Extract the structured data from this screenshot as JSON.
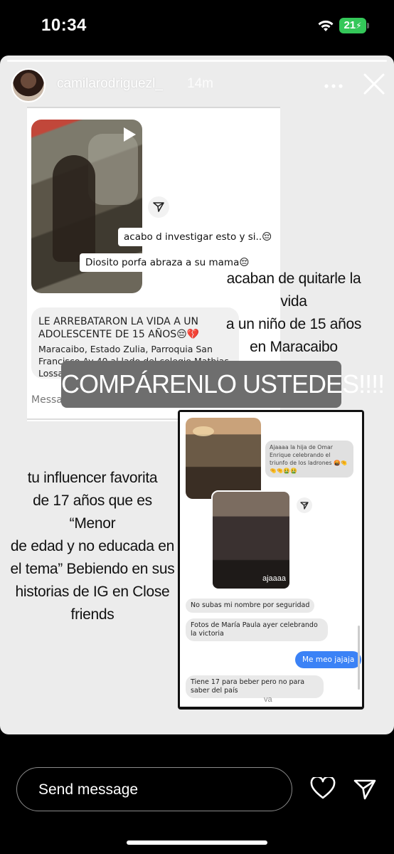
{
  "status_bar": {
    "time": "10:34",
    "battery": "21"
  },
  "story": {
    "username": "camilarodriguezl_",
    "time_ago": "14m",
    "screenshot_1": {
      "bubble_1": "acabo d investigar esto y si..😔",
      "bubble_2": "Diosito porfa abraza a su mama😔",
      "message_lines": [
        "LE ARREBATARON LA VIDA A UN",
        "ADOLESCENTE DE 15 AÑOS😔💔",
        " Maracaibo, Estado Zulia, Parroquia San",
        "Francisco Av 40 al lado del colegio Mathias",
        "Lossada"
      ],
      "input_placeholder": "Message..."
    },
    "overlay_right": [
      "acaban de quitarle la vida",
      "a un niño de 15 años",
      "en Maracaibo"
    ],
    "headline": "COMPÁRENLO USTEDES!!!!",
    "overlay_left": [
      "tu influencer favorita",
      "de 17 años que es “Menor",
      "de edad y no educada en",
      "el tema” Bebiendo en sus",
      "historias de IG en Close",
      "friends"
    ],
    "screenshot_2": {
      "reply_text": "Ajaaaa la hija de Omar Enrique celebrando el triunfo de los ladrones 🤬🤏🤏🤏🤮🤮",
      "photo_label": "ajaaaa",
      "bubble_1": "No subas mi nombre por seguridad",
      "bubble_2": "Fotos de María Paula ayer celebrando la victoria",
      "blue_bubble": "Me meo jajaja",
      "bubble_3": "Tiene 17 para beber pero no para saber del país",
      "footer": "va"
    }
  },
  "bottom_bar": {
    "send_message": "Send message"
  },
  "colors": {
    "accent_blue": "#3b82f6",
    "battery_green": "#34c759",
    "story_bg": "#ececec"
  }
}
